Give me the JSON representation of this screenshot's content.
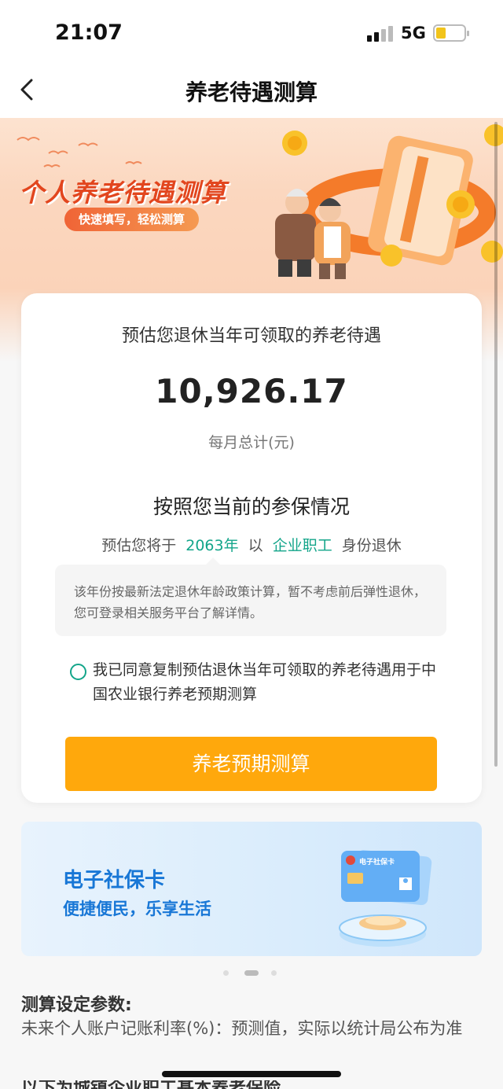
{
  "status_bar": {
    "time": "21:07",
    "network": "5G",
    "battery_level": 0.25
  },
  "nav": {
    "title": "养老待遇测算",
    "back_icon": "chevron-left-icon"
  },
  "banner": {
    "title": "个人养老待遇测算",
    "tagline": "快速填写，轻松测算"
  },
  "result_card": {
    "subtitle": "预估您退休当年可领取的养老待遇",
    "amount": "10,926.17",
    "unit": "每月总计(元)",
    "section_title": "按照您当前的参保情况",
    "retire_prefix": "预估您将于",
    "retire_year": "2063年",
    "retire_middle": "以",
    "retire_identity": "企业职工",
    "retire_suffix": "身份退休",
    "note": "该年份按最新法定退休年龄政策计算，暂不考虑前后弹性退休，您可登录相关服务平台了解详情。",
    "agree_text": "我已同意复制预估退休当年可领取的养老待遇用于中国农业银行养老预期测算",
    "agree_checked": false,
    "button_label": "养老预期测算",
    "highlight_color": "#13a58a",
    "button_color": "#ffa80c"
  },
  "ad_banner": {
    "title": "电子社保卡",
    "subtitle": "便捷便民，乐享生活",
    "card_label": "电子社保卡",
    "carousel_count": 3,
    "carousel_active": 2
  },
  "params": {
    "title": "测算设定参数:",
    "text": "未来个人账户记账利率(%)：预测值，实际以统计局公布为准",
    "next_title": "以下为城镇企业职工基本养老保险"
  }
}
